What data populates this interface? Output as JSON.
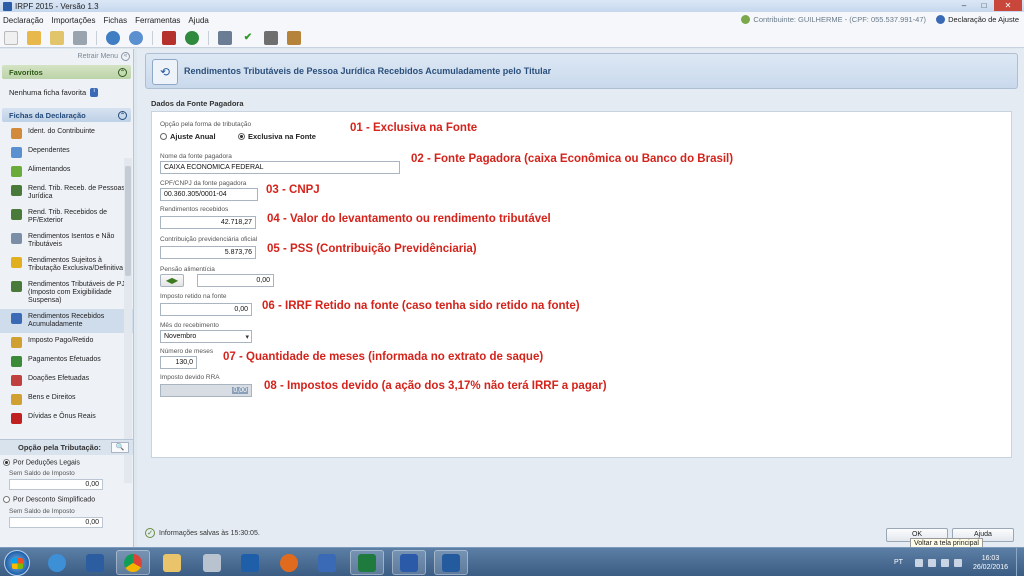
{
  "window": {
    "title": "IRPF 2015 - Versão 1.3",
    "minimize": "–",
    "maximize": "□",
    "close": "✕"
  },
  "menu": {
    "items": [
      "Declaração",
      "Importações",
      "Fichas",
      "Ferramentas",
      "Ajuda"
    ],
    "contributor": "Contribuinte: GUILHERME - (CPF: 055.537.991-47)",
    "adjust": "Declaração de Ajuste"
  },
  "sidebar": {
    "collapse_label": "Retrair Menu",
    "favorites_title": "Favoritos",
    "no_favorites": "Nenhuma ficha favorita",
    "forms_title": "Fichas da Declaração",
    "items": [
      {
        "label": "Ident. do Contribuinte",
        "icon": "person-icon",
        "color": "#d28b3a"
      },
      {
        "label": "Dependentes",
        "icon": "people-icon",
        "color": "#5a8fd0"
      },
      {
        "label": "Alimentandos",
        "icon": "food-icon",
        "color": "#6aab3a"
      },
      {
        "label": "Rend. Trib. Receb. de Pessoas Jurídica",
        "icon": "income-pj-icon",
        "color": "#4a7a3a"
      },
      {
        "label": "Rend. Trib. Recebidos de PF/Exterior",
        "icon": "income-pf-icon",
        "color": "#4a7a3a"
      },
      {
        "label": "Rendimentos Isentos e Não Tributáveis",
        "icon": "exempt-icon",
        "color": "#7a8ea8"
      },
      {
        "label": "Rendimentos Sujeitos à Tributação Exclusiva/Definitiva",
        "icon": "warning-icon",
        "color": "#e0b020"
      },
      {
        "label": "Rendimentos Tributáveis de PJ (Imposto com Exigibilidade Suspensa)",
        "icon": "suspended-icon",
        "color": "#4a7a3a"
      },
      {
        "label": "Rendimentos Recebidos Acumuladamente",
        "icon": "accumulated-icon",
        "color": "#3a6ab5"
      },
      {
        "label": "Imposto Pago/Retido",
        "icon": "tax-paid-icon",
        "color": "#d0a030"
      },
      {
        "label": "Pagamentos Efetuados",
        "icon": "payments-icon",
        "color": "#3a8a3a"
      },
      {
        "label": "Doações Efetuadas",
        "icon": "donations-icon",
        "color": "#c04040"
      },
      {
        "label": "Bens e Direitos",
        "icon": "assets-icon",
        "color": "#d0a030"
      },
      {
        "label": "Dívidas e Ônus Reais",
        "icon": "debts-icon",
        "color": "#c02020"
      }
    ],
    "tax_option": {
      "title": "Opção pela Tributação:",
      "search": "🔍",
      "legal": "Por Deduções Legais",
      "legal_sub": "Sem Saldo de Imposto",
      "legal_value": "0,00",
      "simplified": "Por Desconto Simplificado",
      "simplified_sub": "Sem Saldo de Imposto",
      "simplified_value": "0,00"
    }
  },
  "main": {
    "header_title": "Rendimentos Tributáveis de Pessoa Jurídica Recebidos Acumuladamente pelo Titular",
    "section_title": "Dados da Fonte Pagadora",
    "form": {
      "tax_option_label": "Opção pela forma de tributação",
      "option_annual": "Ajuste Anual",
      "option_exclusive": "Exclusiva na Fonte",
      "source_name_label": "Nome da fonte pagadora",
      "source_name": "CAIXA ECONOMICA FEDERAL",
      "cnpj_label": "CPF/CNPJ da fonte pagadora",
      "cnpj": "00.360.305/0001-04",
      "income_label": "Rendimentos recebidos",
      "income": "42.718,27",
      "pension_contrib_label": "Contribuição previdenciária oficial",
      "pension_contrib": "5.873,76",
      "alimony_label": "Pensão alimentícia",
      "alimony": "0,00",
      "withheld_label": "Imposto retido na fonte",
      "withheld": "0,00",
      "month_label": "Mês do recebimento",
      "month": "Novembro",
      "months_count_label": "Número de meses",
      "months_count": "130,0",
      "rra_tax_label": "Imposto devido RRA",
      "rra_tax": "0,00"
    },
    "annotations": [
      "01 - Exclusiva na Fonte",
      "02 - Fonte Pagadora (caixa Econômica ou Banco do Brasil)",
      "03 - CNPJ",
      "04 -  Valor do levantamento ou rendimento tributável",
      "05 - PSS (Contribuição Previdênciaria)",
      "06 - IRRF Retido na fonte (caso tenha sido retido na fonte)",
      "07 - Quantidade de meses (informada no extrato de saque)",
      "08 - Impostos devido (a ação dos 3,17% não terá IRRF a pagar)"
    ],
    "status": "Informações salvas às 15:30:05.",
    "ok_button": "OK",
    "help_button": "Ajuda",
    "tooltip": "Voltar a tela principal"
  },
  "taskbar": {
    "lang": "PT",
    "time": "16:03",
    "date": "26/02/2016"
  },
  "colors": {
    "annotation": "#d4231b",
    "header": "#2b4f7c",
    "taskbar": "#3b5c83"
  }
}
